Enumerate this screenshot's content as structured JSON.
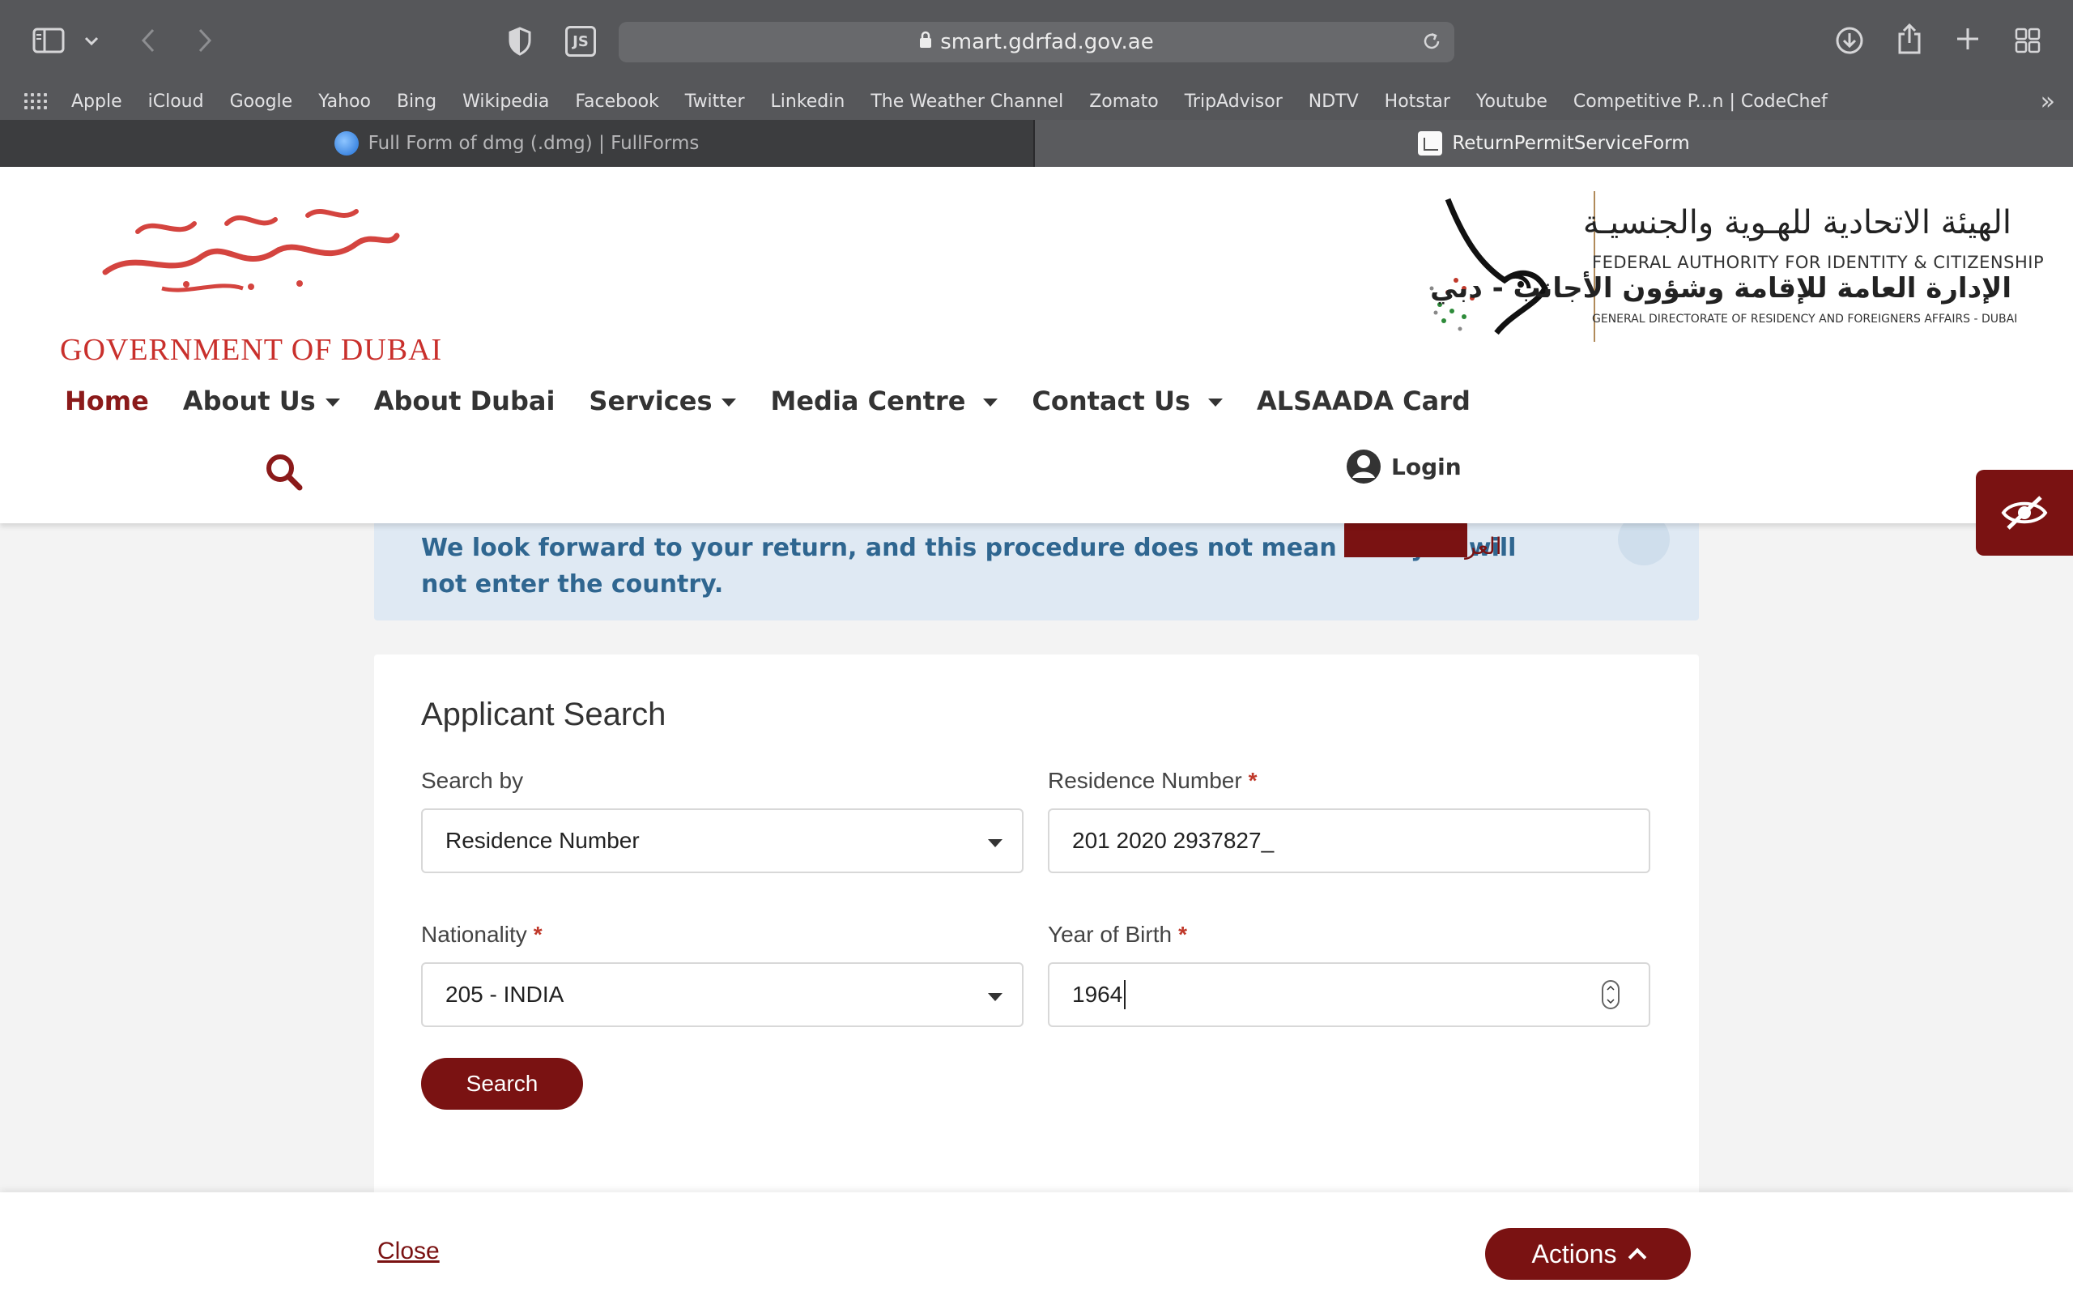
{
  "browser": {
    "url": "smart.gdrfad.gov.ae",
    "bookmarks": [
      "Apple",
      "iCloud",
      "Google",
      "Yahoo",
      "Bing",
      "Wikipedia",
      "Facebook",
      "Twitter",
      "Linkedin",
      "The Weather Channel",
      "Zomato",
      "TripAdvisor",
      "NDTV",
      "Hotstar",
      "Youtube",
      "Competitive P...n | CodeChef"
    ],
    "tabs": [
      {
        "title": "Full Form of dmg (.dmg) | FullForms",
        "active": false
      },
      {
        "title": "ReturnPermitServiceForm",
        "active": true
      }
    ],
    "icons": {
      "sidebar": "sidebar-icon",
      "back": "back-icon",
      "forward": "forward-icon",
      "shield": "shield-icon",
      "js": "JS",
      "download": "download-icon",
      "share": "share-icon",
      "new_tab": "plus-icon",
      "tab_overview": "grid-icon"
    }
  },
  "header": {
    "gov_logo_text": "GOVERNMENT OF DUBAI",
    "gov_logo_arabic": "حكومة دبي",
    "ica_arabic_1": "الهيئة الاتحادية للهـوية والجنسيـة",
    "ica_english_1": "FEDERAL AUTHORITY FOR IDENTITY & CITIZENSHIP",
    "ica_arabic_2": "الإدارة العامة للإقامة وشؤون الأجانب - دبي",
    "ica_english_2": "GENERAL DIRECTORATE OF RESIDENCY AND FOREIGNERS AFFAIRS - DUBAI",
    "nav": [
      {
        "label": "Home",
        "dropdown": false,
        "active": true
      },
      {
        "label": "About Us",
        "dropdown": true,
        "active": false
      },
      {
        "label": "About Dubai",
        "dropdown": false,
        "active": false
      },
      {
        "label": "Services",
        "dropdown": true,
        "active": false
      },
      {
        "label": "Media Centre",
        "dropdown": true,
        "active": false
      },
      {
        "label": "Contact Us",
        "dropdown": true,
        "active": false
      },
      {
        "label": "ALSAADA Card",
        "dropdown": false,
        "active": false
      }
    ],
    "login_label": "Login",
    "language_label": "العربية"
  },
  "info_banner": {
    "text": "We look forward to your return, and this procedure does not mean that you will not enter the country."
  },
  "form": {
    "title": "Applicant Search",
    "search_by_label": "Search by",
    "search_by_value": "Residence Number",
    "residence_label": "Residence Number",
    "residence_value": "201 2020 2937827_",
    "nationality_label": "Nationality",
    "nationality_value": "205 - INDIA",
    "yob_label": "Year of Birth",
    "yob_value": "1964",
    "required_mark": "*",
    "search_button": "Search"
  },
  "footer": {
    "close_label": "Close",
    "actions_label": "Actions"
  },
  "colors": {
    "brand": "#7a1212",
    "chrome": "#56575a",
    "info_bg": "#dfe9f3",
    "info_text": "#2f6690"
  }
}
